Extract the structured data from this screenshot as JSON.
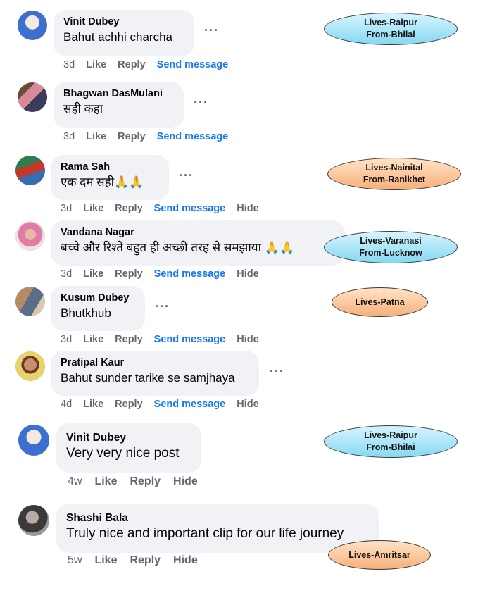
{
  "comments": [
    {
      "name": "Vinit Dubey",
      "text": "Bahut achhi charcha",
      "time": "3d",
      "actions": [
        "Like",
        "Reply"
      ],
      "send": "Send message",
      "hide": ""
    },
    {
      "name": "Bhagwan DasMulani",
      "text": "सही कहा",
      "time": "3d",
      "actions": [
        "Like",
        "Reply"
      ],
      "send": "Send message",
      "hide": ""
    },
    {
      "name": "Rama Sah",
      "text": "एक दम सही🙏🙏",
      "time": "3d",
      "actions": [
        "Like",
        "Reply"
      ],
      "send": "Send message",
      "hide": "Hide"
    },
    {
      "name": "Vandana Nagar",
      "text": "बच्चे और रिश्ते बहुत ही अच्छी तरह से समझाया 🙏🙏",
      "time": "3d",
      "actions": [
        "Like",
        "Reply"
      ],
      "send": "Send message",
      "hide": "Hide"
    },
    {
      "name": "Kusum Dubey",
      "text": "Bhutkhub",
      "time": "3d",
      "actions": [
        "Like",
        "Reply"
      ],
      "send": "Send message",
      "hide": "Hide"
    },
    {
      "name": "Pratipal Kaur",
      "text": "Bahut sunder tarike se samjhaya",
      "time": "4d",
      "actions": [
        "Like",
        "Reply"
      ],
      "send": "Send message",
      "hide": "Hide"
    },
    {
      "name": "Vinit Dubey",
      "text": "Very very nice post",
      "time": "4w",
      "actions": [
        "Like",
        "Reply"
      ],
      "send": "",
      "hide": "Hide"
    },
    {
      "name": "Shashi Bala",
      "text": "Truly nice and important clip for our life journey",
      "time": "5w",
      "actions": [
        "Like",
        "Reply"
      ],
      "send": "",
      "hide": "Hide"
    }
  ],
  "more_icon": "more-dots-icon",
  "tags": [
    {
      "line1": "Lives-Raipur",
      "line2": "From-Bhilai",
      "color": "blue"
    },
    {
      "line1": "Lives-Nainital",
      "line2": "From-Ranikhet",
      "color": "orange"
    },
    {
      "line1": "Lives-Varanasi",
      "line2": "From-Lucknow",
      "color": "blue"
    },
    {
      "line1": "Lives-Patna",
      "line2": "",
      "color": "orange"
    },
    {
      "line1": "Lives-Raipur",
      "line2": "From-Bhilai",
      "color": "blue"
    },
    {
      "line1": "Lives-Amritsar",
      "line2": "",
      "color": "orange"
    }
  ]
}
